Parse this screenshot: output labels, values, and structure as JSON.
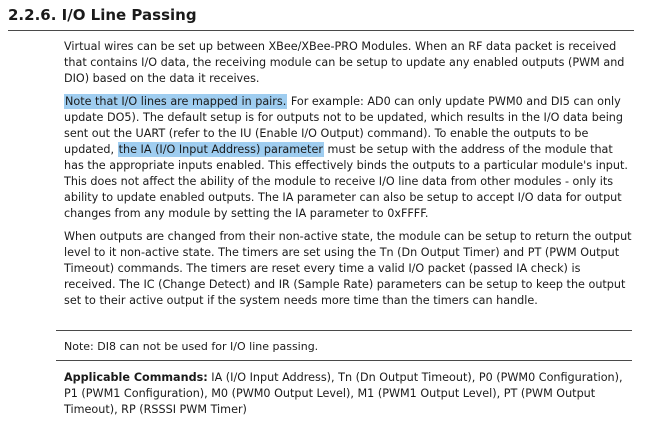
{
  "section": {
    "title": "2.2.6. I/O Line Passing"
  },
  "paragraphs": {
    "p1": "Virtual wires can be set up between XBee/XBee-PRO Modules. When an RF data packet is received that contains I/O data, the receiving module can be setup to update any enabled outputs (PWM and DIO) based on the data it receives.",
    "p2_highlight": "Note that I/O lines are mapped in pairs.",
    "p2_part1": " For example: AD0 can only update PWM0 and DI5 can only update DO5). The default setup is for outputs not to be updated, which results in the I/O data being sent out the UART (refer to the IU (Enable I/O Output) command). To enable the outputs to be updated, ",
    "p2_highlight2": "the IA (I/O Input Address) parameter",
    "p2_part2": " must be setup with the address of the module that has the appropriate inputs enabled. This effectively binds the outputs to a particular module's input. This does not affect the ability of the module to receive I/O line data from other modules - only its ability to update enabled outputs. The IA parameter can also be setup to accept I/O data for output changes from any module by setting the IA parameter to 0xFFFF.",
    "p3": "When outputs are changed from their non-active state, the module can be setup to return the output level to it non-active state. The timers are set using the Tn (Dn Output Timer) and PT (PWM Output Timeout) commands. The timers are reset every time a valid I/O packet (passed IA check) is received. The IC (Change Detect) and IR (Sample Rate) parameters can be setup to keep the output set to their active output if the system needs more time than the timers can handle."
  },
  "note": {
    "text": "Note: DI8 can not be used for I/O line passing."
  },
  "applicable": {
    "label": "Applicable Commands:",
    "text": " IA (I/O Input Address), Tn (Dn Output Timeout), P0 (PWM0 Configuration), P1 (PWM1 Configuration), M0 (PWM0 Output Level), M1 (PWM1 Output Level), PT (PWM Output Timeout), RP (RSSSI PWM Timer)"
  },
  "colors": {
    "highlight": "#9fcdf0",
    "rule": "#4a4a4a",
    "text": "#1a1a1a"
  }
}
